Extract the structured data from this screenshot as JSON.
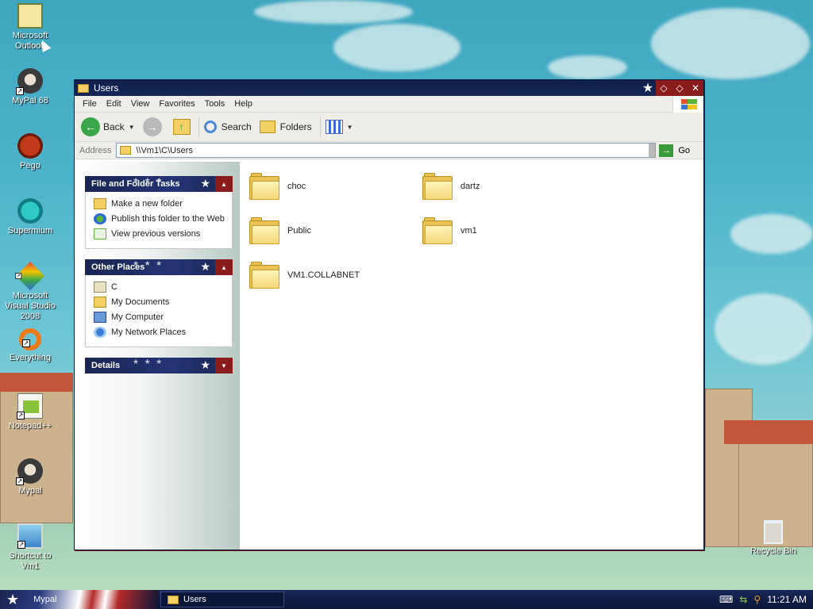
{
  "desktop": {
    "icons": [
      {
        "label": "Microsoft Outlook",
        "icon": "outlook-icon"
      },
      {
        "label": "MyPal 68",
        "icon": "mypal-icon"
      },
      {
        "label": "Pego",
        "icon": "pego-icon"
      },
      {
        "label": "Supermium",
        "icon": "supermium-icon"
      },
      {
        "label": "Microsoft Visual Studio 2008",
        "icon": "visual-studio-icon"
      },
      {
        "label": "Everything",
        "icon": "everything-icon"
      },
      {
        "label": "Notepad++",
        "icon": "notepadpp-icon"
      },
      {
        "label": "Mypal",
        "icon": "mypal-icon"
      },
      {
        "label": "Shortcut to Vm1",
        "icon": "network-computer-icon"
      },
      {
        "label": "Recycle Bin",
        "icon": "recycle-bin-icon"
      }
    ]
  },
  "window": {
    "title": "Users",
    "menu": [
      "File",
      "Edit",
      "View",
      "Favorites",
      "Tools",
      "Help"
    ],
    "toolbar": {
      "back": "Back",
      "search": "Search",
      "folders": "Folders"
    },
    "address": {
      "label": "Address",
      "value": "\\\\Vm1\\C\\Users",
      "go": "Go"
    },
    "panels": [
      {
        "title": "File and Folder Tasks",
        "items": [
          {
            "label": "Make a new folder",
            "icon": "new-folder-icon"
          },
          {
            "label": "Publish this folder to the Web",
            "icon": "globe-icon"
          },
          {
            "label": "View previous versions",
            "icon": "previous-versions-icon"
          }
        ]
      },
      {
        "title": "Other Places",
        "items": [
          {
            "label": "C",
            "icon": "drive-icon"
          },
          {
            "label": "My Documents",
            "icon": "my-documents-icon"
          },
          {
            "label": "My Computer",
            "icon": "my-computer-icon"
          },
          {
            "label": "My Network Places",
            "icon": "network-places-icon"
          }
        ]
      },
      {
        "title": "Details",
        "items": []
      }
    ],
    "files": [
      "choc",
      "dartz",
      "Public",
      "vm1",
      "VM1.COLLABNET"
    ]
  },
  "taskbar": {
    "start_item": "Mypal",
    "active_window": "Users",
    "clock": "11:21 AM"
  }
}
